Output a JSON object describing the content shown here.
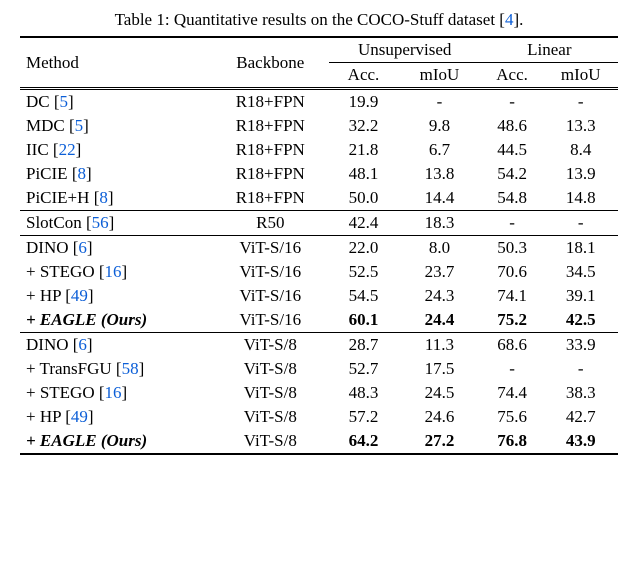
{
  "caption": {
    "prefix": "Table 1: Quantitative results on the COCO-Stuff dataset [",
    "cite": "4",
    "suffix": "]."
  },
  "headers": {
    "method": "Method",
    "backbone": "Backbone",
    "unsup": "Unsupervised",
    "linear": "Linear",
    "acc": "Acc.",
    "miou": "mIoU"
  },
  "chart_data": {
    "type": "table",
    "sections": [
      {
        "rows": [
          {
            "method": "DC",
            "cite": "5",
            "backbone": "R18+FPN",
            "u_acc": "19.9",
            "u_miou": "-",
            "l_acc": "-",
            "l_miou": "-",
            "bold": false,
            "ital": false
          },
          {
            "method": "MDC",
            "cite": "5",
            "backbone": "R18+FPN",
            "u_acc": "32.2",
            "u_miou": "9.8",
            "l_acc": "48.6",
            "l_miou": "13.3",
            "bold": false,
            "ital": false
          },
          {
            "method": "IIC",
            "cite": "22",
            "backbone": "R18+FPN",
            "u_acc": "21.8",
            "u_miou": "6.7",
            "l_acc": "44.5",
            "l_miou": "8.4",
            "bold": false,
            "ital": false
          },
          {
            "method": "PiCIE",
            "cite": "8",
            "backbone": "R18+FPN",
            "u_acc": "48.1",
            "u_miou": "13.8",
            "l_acc": "54.2",
            "l_miou": "13.9",
            "bold": false,
            "ital": false
          },
          {
            "method": "PiCIE+H",
            "cite": "8",
            "backbone": "R18+FPN",
            "u_acc": "50.0",
            "u_miou": "14.4",
            "l_acc": "54.8",
            "l_miou": "14.8",
            "bold": false,
            "ital": false
          }
        ]
      },
      {
        "rows": [
          {
            "method": "SlotCon",
            "cite": "56",
            "backbone": "R50",
            "u_acc": "42.4",
            "u_miou": "18.3",
            "l_acc": "-",
            "l_miou": "-",
            "bold": false,
            "ital": false
          }
        ]
      },
      {
        "rows": [
          {
            "method": "DINO",
            "cite": "6",
            "backbone": "ViT-S/16",
            "u_acc": "22.0",
            "u_miou": "8.0",
            "l_acc": "50.3",
            "l_miou": "18.1",
            "bold": false,
            "ital": false
          },
          {
            "method": "+ STEGO",
            "cite": "16",
            "backbone": "ViT-S/16",
            "u_acc": "52.5",
            "u_miou": "23.7",
            "l_acc": "70.6",
            "l_miou": "34.5",
            "bold": false,
            "ital": false
          },
          {
            "method": "+ HP",
            "cite": "49",
            "backbone": "ViT-S/16",
            "u_acc": "54.5",
            "u_miou": "24.3",
            "l_acc": "74.1",
            "l_miou": "39.1",
            "bold": false,
            "ital": false
          },
          {
            "method": "+ EAGLE (Ours)",
            "cite": "",
            "backbone": "ViT-S/16",
            "u_acc": "60.1",
            "u_miou": "24.4",
            "l_acc": "75.2",
            "l_miou": "42.5",
            "bold": true,
            "ital": true
          }
        ]
      },
      {
        "rows": [
          {
            "method": "DINO",
            "cite": "6",
            "backbone": "ViT-S/8",
            "u_acc": "28.7",
            "u_miou": "11.3",
            "l_acc": "68.6",
            "l_miou": "33.9",
            "bold": false,
            "ital": false
          },
          {
            "method": "+ TransFGU",
            "cite": "58",
            "backbone": "ViT-S/8",
            "u_acc": "52.7",
            "u_miou": "17.5",
            "l_acc": "-",
            "l_miou": "-",
            "bold": false,
            "ital": false
          },
          {
            "method": "+ STEGO",
            "cite": "16",
            "backbone": "ViT-S/8",
            "u_acc": "48.3",
            "u_miou": "24.5",
            "l_acc": "74.4",
            "l_miou": "38.3",
            "bold": false,
            "ital": false
          },
          {
            "method": "+ HP",
            "cite": "49",
            "backbone": "ViT-S/8",
            "u_acc": "57.2",
            "u_miou": "24.6",
            "l_acc": "75.6",
            "l_miou": "42.7",
            "bold": false,
            "ital": false
          },
          {
            "method": "+ EAGLE (Ours)",
            "cite": "",
            "backbone": "ViT-S/8",
            "u_acc": "64.2",
            "u_miou": "27.2",
            "l_acc": "76.8",
            "l_miou": "43.9",
            "bold": true,
            "ital": true
          }
        ]
      }
    ]
  }
}
